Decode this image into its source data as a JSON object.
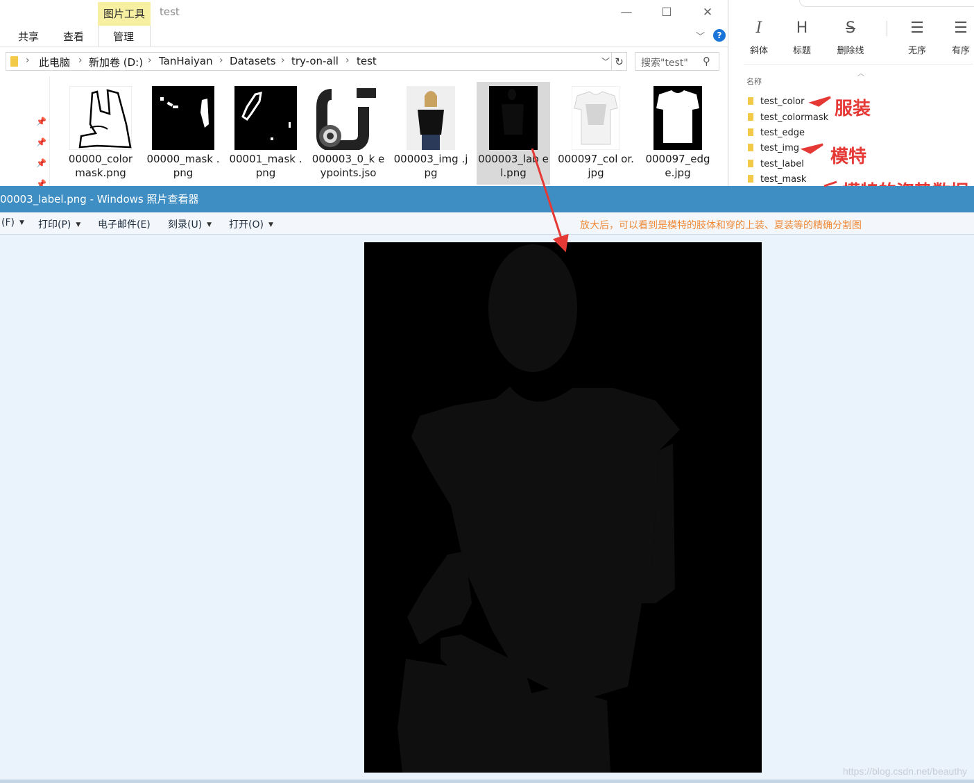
{
  "explorer": {
    "context_tab": "图片工具",
    "title": "test",
    "tabs": {
      "share": "共享",
      "view": "查看",
      "manage": "管理"
    },
    "breadcrumb": [
      "此电脑",
      "新加卷 (D:)",
      "TanHaiyan",
      "Datasets",
      "try-on-all",
      "test"
    ],
    "search_placeholder": "搜索\"test\"",
    "files": [
      {
        "name": "00000_color mask.png"
      },
      {
        "name": "00000_mask .png"
      },
      {
        "name": "00001_mask .png"
      },
      {
        "name": "000003_0_k eypoints.jso"
      },
      {
        "name": "000003_img .jpg"
      },
      {
        "name": "000003_lab el.png",
        "selected": true
      },
      {
        "name": "000097_col or.jpg"
      },
      {
        "name": "000097_edg e.jpg"
      }
    ]
  },
  "editor_panel": {
    "toolbar": [
      {
        "icon": "italic-icon",
        "glyph": "I",
        "label": "斜体"
      },
      {
        "icon": "heading-icon",
        "glyph": "H",
        "label": "标题"
      },
      {
        "icon": "strikethrough-icon",
        "glyph": "S",
        "label": "删除线"
      },
      {
        "icon": "unordered-list-icon",
        "glyph": "☰",
        "label": "无序"
      },
      {
        "icon": "ordered-list-icon",
        "glyph": "☰",
        "label": "有序"
      }
    ],
    "name_column": "名称",
    "folders": [
      "test_color",
      "test_colormask",
      "test_edge",
      "test_img",
      "test_label",
      "test_mask"
    ],
    "annotations": {
      "clothes": "服装",
      "model": "模特",
      "pose_partial": "模特的姿势数据"
    }
  },
  "viewer": {
    "title": "00003_label.png - Windows 照片查看器",
    "menu": [
      {
        "label": "(F)",
        "dropdown": true
      },
      {
        "label": "打印(P)",
        "dropdown": true
      },
      {
        "label": "电子邮件(E)",
        "dropdown": false
      },
      {
        "label": "刻录(U)",
        "dropdown": true
      },
      {
        "label": "打开(O)",
        "dropdown": true
      }
    ],
    "annotation": "放大后，可以看到是模特的肢体和穿的上装、夏装等的精确分割图",
    "watermark": "https://blog.csdn.net/beauthy"
  },
  "colors": {
    "viewer_titlebar": "#3e8ec3",
    "annotation_red": "#e53935",
    "annotation_orange": "#f08a37",
    "context_tab": "#f7efa1",
    "segmentation_region": "#0f0f0f"
  }
}
